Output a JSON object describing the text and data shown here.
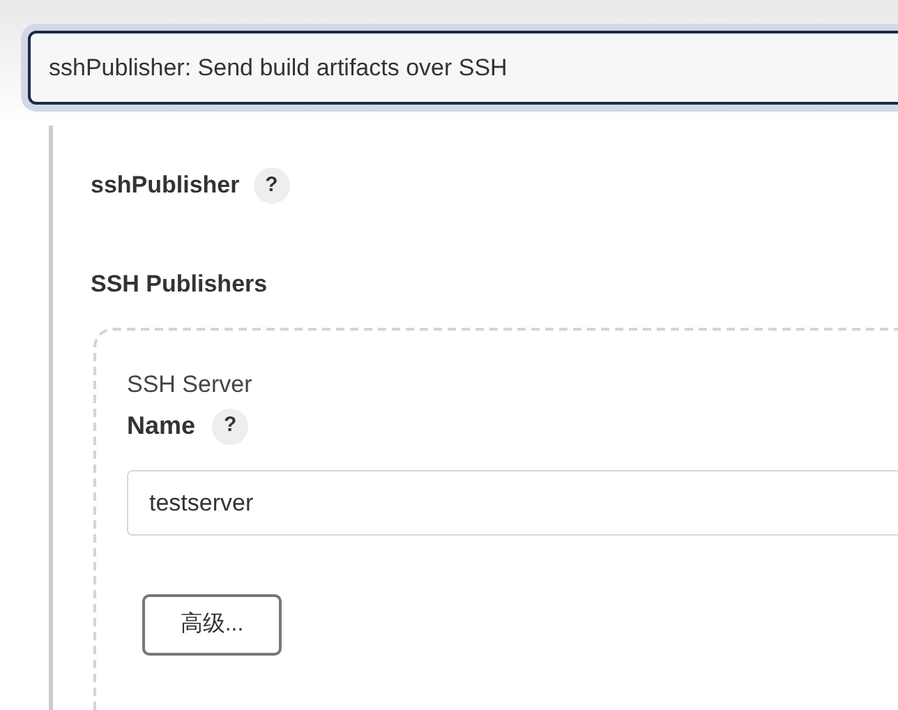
{
  "step_select": {
    "value": "sshPublisher: Send build artifacts over SSH"
  },
  "section": {
    "label": "sshPublisher",
    "help": "?"
  },
  "publishers": {
    "title": "SSH Publishers",
    "server": {
      "heading": "SSH Server",
      "name_label": "Name",
      "help": "?",
      "name_value": "testserver",
      "advanced_button": "高级..."
    }
  }
}
